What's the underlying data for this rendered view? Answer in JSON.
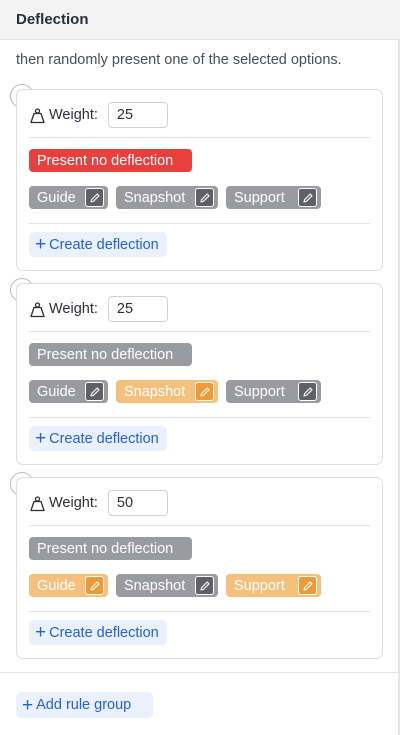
{
  "header": {
    "title": "Deflection"
  },
  "intro_text": "then randomly present one of the selected options.",
  "weight_label": "Weight:",
  "create_deflection_label": "Create deflection",
  "add_rule_group_label": "Add rule group",
  "colors": {
    "no_deflection_active": "#e8403f",
    "option_inactive": "#9a9ba1",
    "option_selected": "#f5c07c",
    "link_blue": "#2461d1"
  },
  "groups": [
    {
      "weight": "25",
      "no_deflection": {
        "label": "Present no deflection",
        "state": "active"
      },
      "options": [
        {
          "label": "Guide",
          "state": "inactive"
        },
        {
          "label": "Snapshot",
          "state": "inactive"
        },
        {
          "label": "Support",
          "state": "inactive"
        }
      ]
    },
    {
      "weight": "25",
      "no_deflection": {
        "label": "Present no deflection",
        "state": "inactive"
      },
      "options": [
        {
          "label": "Guide",
          "state": "inactive"
        },
        {
          "label": "Snapshot",
          "state": "selected"
        },
        {
          "label": "Support",
          "state": "inactive"
        }
      ]
    },
    {
      "weight": "50",
      "no_deflection": {
        "label": "Present no deflection",
        "state": "inactive"
      },
      "options": [
        {
          "label": "Guide",
          "state": "selected"
        },
        {
          "label": "Snapshot",
          "state": "inactive"
        },
        {
          "label": "Support",
          "state": "selected"
        }
      ]
    }
  ]
}
